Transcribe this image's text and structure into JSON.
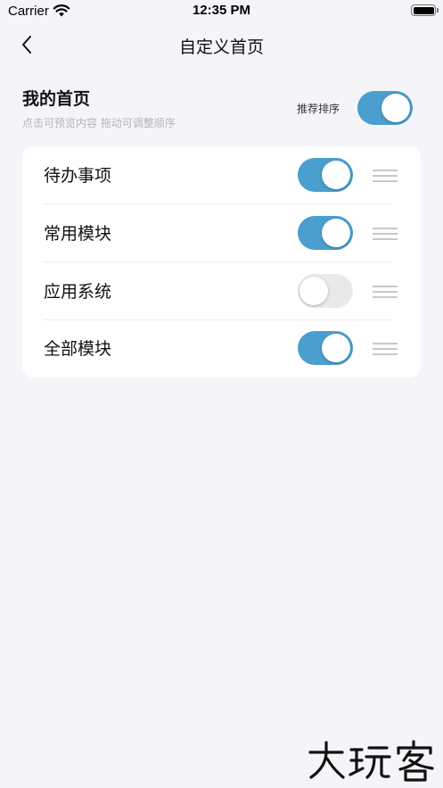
{
  "status": {
    "carrier": "Carrier",
    "time": "12:35 PM"
  },
  "nav": {
    "title": "自定义首页"
  },
  "section": {
    "title": "我的首页",
    "hint": "点击可预览内容 拖动可调整顺序",
    "recommend_label": "推荐排序",
    "recommend_on": true
  },
  "modules": [
    {
      "label": "待办事项",
      "enabled": true
    },
    {
      "label": "常用模块",
      "enabled": true
    },
    {
      "label": "应用系统",
      "enabled": false
    },
    {
      "label": "全部模块",
      "enabled": true
    }
  ],
  "colors": {
    "accent": "#4a9fce",
    "background": "#f5f5f9",
    "card": "#ffffff"
  },
  "icons": {
    "back": "chevron-left-icon",
    "drag": "drag-handle-icon",
    "wifi": "wifi-icon",
    "battery": "battery-icon"
  },
  "watermark": {
    "text": "大玩客"
  }
}
